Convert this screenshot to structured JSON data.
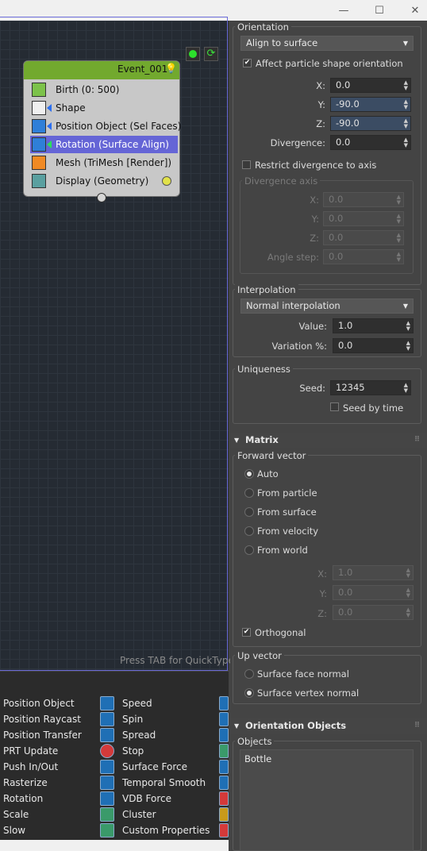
{
  "window": {
    "minimize": "—",
    "maximize": "☐",
    "close": "✕"
  },
  "flow": {
    "node_title": "Event_001",
    "operators": [
      {
        "label": "Birth (0: 500)",
        "icon": "birth-icon",
        "selected": false
      },
      {
        "label": "Shape",
        "icon": "shape-icon",
        "selected": false
      },
      {
        "label": "Position Object (Sel Faces)",
        "icon": "position-object-icon",
        "selected": false
      },
      {
        "label": "Rotation (Surface Align)",
        "icon": "rotation-icon",
        "selected": true
      },
      {
        "label": "Mesh (TriMesh [Render])",
        "icon": "mesh-icon",
        "selected": false
      },
      {
        "label": "Display (Geometry)",
        "icon": "display-icon",
        "selected": false
      }
    ],
    "hint": "Press TAB for QuickType"
  },
  "depot": {
    "col1": [
      "Position Object",
      "Position Raycast",
      "Position Transfer",
      "PRT Update",
      "Push In/Out",
      "Rasterize",
      "Rotation",
      "Scale",
      "Slow"
    ],
    "col2": [
      "Speed",
      "Spin",
      "Spread",
      "Stop",
      "Surface Force",
      "Temporal Smooth",
      "VDB Force",
      "Cluster",
      "Custom Properties"
    ]
  },
  "orientation": {
    "group_title": "Orientation",
    "mode": "Align to surface",
    "affect_label": "Affect particle shape orientation",
    "affect_checked": true,
    "x_label": "X:",
    "x": "0.0",
    "y_label": "Y:",
    "y": "-90.0",
    "z_label": "Z:",
    "z": "-90.0",
    "div_label": "Divergence:",
    "divergence": "0.0",
    "restrict_label": "Restrict divergence to axis",
    "axis_group": "Divergence axis",
    "ax_x_label": "X:",
    "ax_x": "0.0",
    "ax_y_label": "Y:",
    "ax_y": "0.0",
    "ax_z_label": "Z:",
    "ax_z": "0.0",
    "angle_label": "Angle step:",
    "angle": "0.0"
  },
  "interpolation": {
    "group_title": "Interpolation",
    "mode": "Normal interpolation",
    "value_label": "Value:",
    "value": "1.0",
    "variation_label": "Variation %:",
    "variation": "0.0"
  },
  "uniqueness": {
    "group_title": "Uniqueness",
    "seed_label": "Seed:",
    "seed": "12345",
    "seed_time_label": "Seed by time"
  },
  "matrix": {
    "rollout": "Matrix",
    "forward_title": "Forward vector",
    "forward_options": [
      "Auto",
      "From particle",
      "From surface",
      "From velocity",
      "From world"
    ],
    "forward_selected": 0,
    "fx_label": "X:",
    "fx": "1.0",
    "fy_label": "Y:",
    "fy": "0.0",
    "fz_label": "Z:",
    "fz": "0.0",
    "orthogonal_label": "Orthogonal",
    "up_title": "Up vector",
    "up_options": [
      "Surface face normal",
      "Surface vertex normal"
    ],
    "up_selected": 1
  },
  "orientation_objects": {
    "rollout": "Orientation Objects",
    "objects_title": "Objects",
    "items": [
      "Bottle"
    ]
  }
}
